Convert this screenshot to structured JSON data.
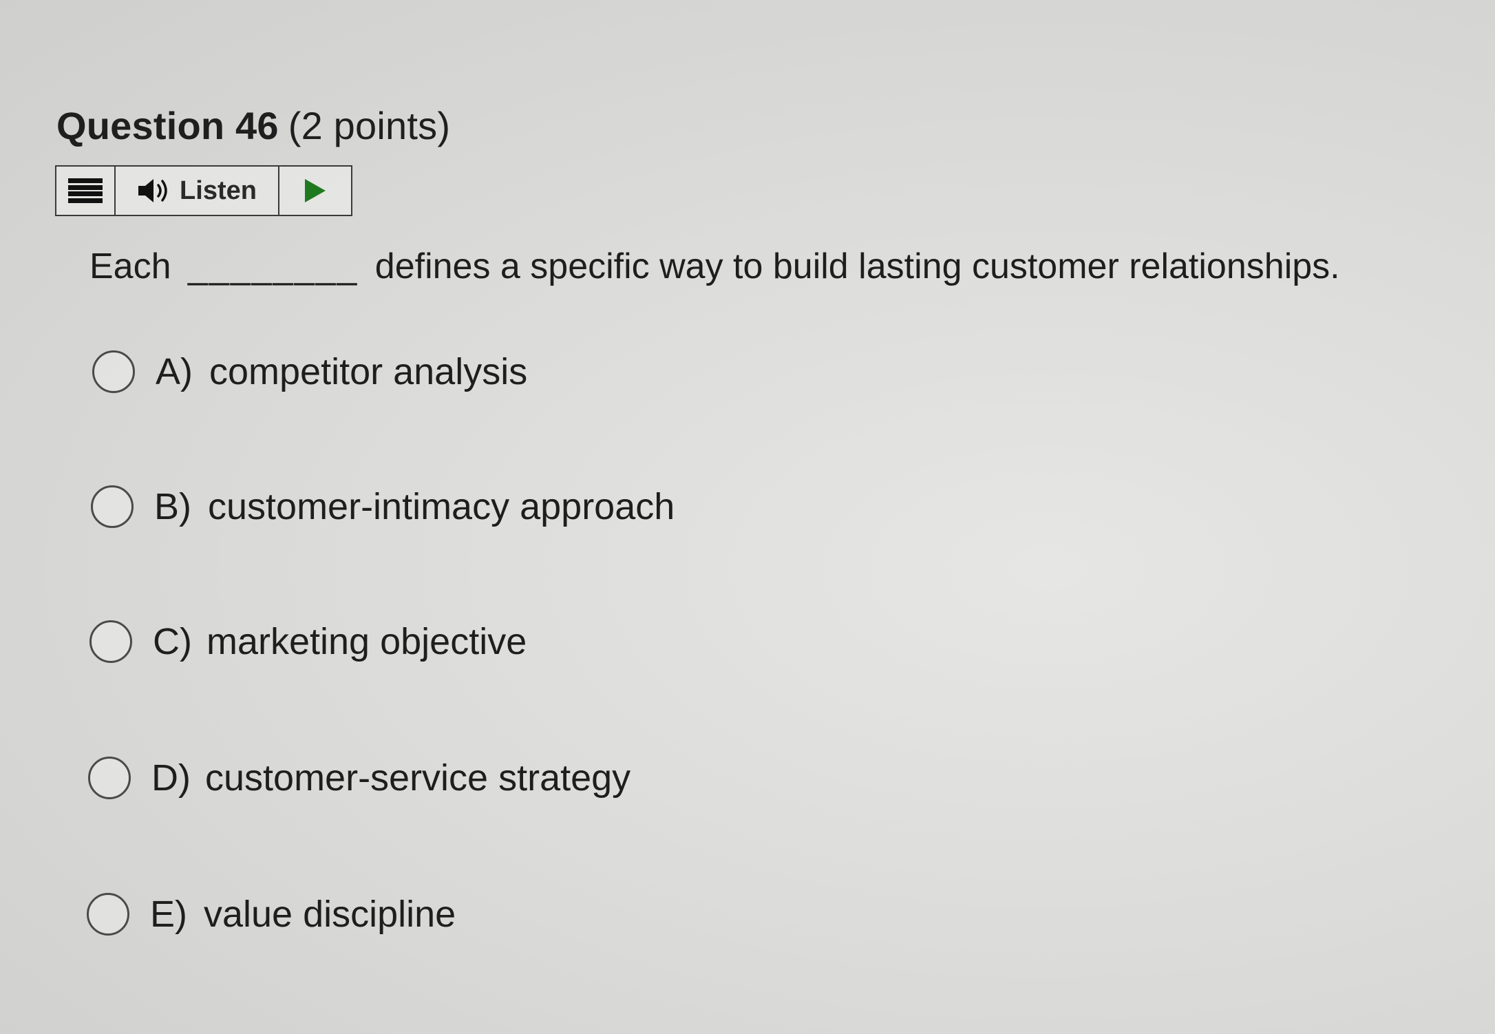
{
  "question": {
    "number_label": "Question 46",
    "points_label": "(2 points)"
  },
  "toolbar": {
    "menu_icon": "menu-icon",
    "speaker_icon": "speaker-icon",
    "listen_label": "Listen",
    "play_icon": "play-icon"
  },
  "stem": {
    "before": "Each",
    "blank": "________",
    "after": "defines a specific way to build lasting customer relationships."
  },
  "options": [
    {
      "letter": "A)",
      "text": "competitor analysis",
      "selected": false
    },
    {
      "letter": "B)",
      "text": "customer-intimacy approach",
      "selected": false
    },
    {
      "letter": "C)",
      "text": "marketing objective",
      "selected": false
    },
    {
      "letter": "D)",
      "text": "customer-service strategy",
      "selected": false
    },
    {
      "letter": "E)",
      "text": "value discipline",
      "selected": false
    }
  ],
  "colors": {
    "text": "#1e1e1e",
    "border": "#3a3a3a",
    "play": "#1f7a1f"
  }
}
